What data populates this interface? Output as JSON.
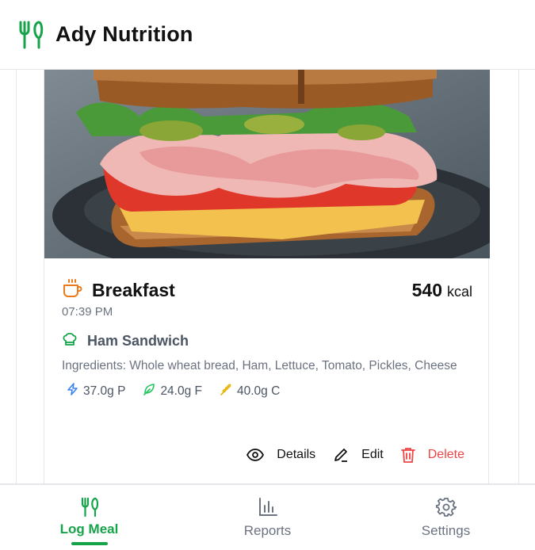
{
  "app": {
    "title": "Ady Nutrition",
    "logo_icon": "utensils-icon",
    "accent": "#16a34a"
  },
  "meal": {
    "type": "Breakfast",
    "type_icon": "coffee-cup-icon",
    "calories": "540",
    "calorie_unit": "kcal",
    "time": "07:39 PM",
    "food_icon": "chef-hat-icon",
    "food_name": "Ham Sandwich",
    "ingredients": "Ingredients: Whole wheat bread, Ham, Lettuce, Tomato, Pickles, Cheese",
    "macros": {
      "protein": "37.0g P",
      "fat": "24.0g F",
      "carbs": "40.0g C"
    },
    "actions": {
      "details": "Details",
      "edit": "Edit",
      "delete": "Delete"
    },
    "delete_color": "#ef4444"
  },
  "nav": {
    "tabs": [
      {
        "label": "Log Meal",
        "icon": "utensils-icon",
        "active": true
      },
      {
        "label": "Reports",
        "icon": "bar-chart-icon",
        "active": false
      },
      {
        "label": "Settings",
        "icon": "gear-icon",
        "active": false
      }
    ]
  }
}
